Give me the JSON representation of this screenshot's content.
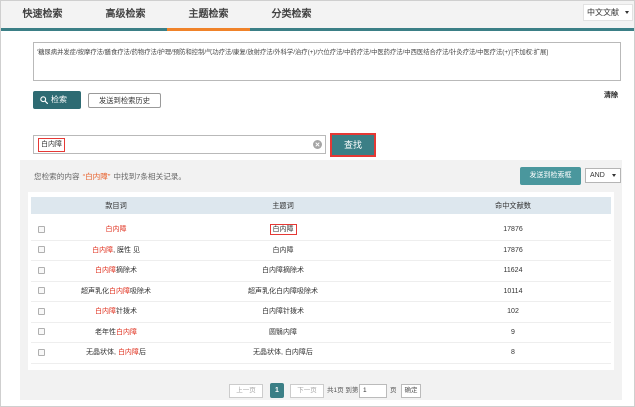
{
  "tabs": [
    {
      "label": "快速检索",
      "active": false
    },
    {
      "label": "高级检索",
      "active": false
    },
    {
      "label": "主题检索",
      "active": true
    },
    {
      "label": "分类检索",
      "active": false
    }
  ],
  "database": {
    "selected": "中文文献",
    "icon": "caret-down-icon"
  },
  "query_box": {
    "text": "'糖尿病并发症/按摩疗法/膳食疗法/药物疗法/护理/预防和控制/气功疗法/康复/放射疗法/外科学/治疗(+)/穴位疗法/中药疗法/中医药疗法/中西医结合疗法/针灸疗法/中医疗法(+)'[不加权:扩展]"
  },
  "actions": {
    "search_label": "检索",
    "search_icon": "search-icon",
    "send_history_label": "发送到检索历史",
    "clear_label": "清除"
  },
  "lookup": {
    "value": "白内障",
    "clear_icon": "clear-circle-icon",
    "button_label": "查找"
  },
  "results": {
    "summary": {
      "prefix": "您检索的内容",
      "term": "“白内障”",
      "suffix": "中找到7条相关记录。"
    },
    "send_button_label": "发送到检索框",
    "operator": {
      "selected": "AND",
      "icon": "caret-down-icon"
    },
    "columns": {
      "entry": "款目词",
      "subject": "主题词",
      "count": "命中文献数"
    },
    "rows": [
      {
        "checked": false,
        "entry": {
          "pre": "",
          "match": "白内障",
          "post": ""
        },
        "subject": "白内障",
        "count": 17876
      },
      {
        "checked": false,
        "entry": {
          "pre": "",
          "match": "白内障",
          "post": ", 膜性 见"
        },
        "subject": "白内障",
        "count": 17876
      },
      {
        "checked": false,
        "entry": {
          "pre": "",
          "match": "白内障",
          "post": "摘除术"
        },
        "subject": "白内障摘除术",
        "count": 11624
      },
      {
        "checked": false,
        "entry": {
          "pre": "超声乳化",
          "match": "白内障",
          "post": "吸除术"
        },
        "subject": "超声乳化白内障吸除术",
        "count": 10114
      },
      {
        "checked": false,
        "entry": {
          "pre": "",
          "match": "白内障",
          "post": "针拨术"
        },
        "subject": "白内障针拨术",
        "count": 102
      },
      {
        "checked": false,
        "entry": {
          "pre": "老年性",
          "match": "白内障",
          "post": ""
        },
        "subject": "圆翳内障",
        "count": 9
      },
      {
        "checked": false,
        "entry": {
          "pre": "无晶状体, ",
          "match": "白内障",
          "post": "后"
        },
        "subject": "无晶状体, 白内障后",
        "count": 8
      }
    ]
  },
  "pagination": {
    "prev_label": "上一页",
    "current_page": "1",
    "next_label": "下一页",
    "total_text": "共1页 到第",
    "goto_value": "1",
    "page_unit": "页",
    "confirm_label": "确定"
  },
  "colors": {
    "accent_teal": "#3b7f86",
    "accent_teal_dark": "#2e6b73",
    "accent_teal_light": "#4a979d",
    "active_tab": "#f0832a",
    "match_highlight": "#e0301e",
    "summary_term": "#e8612c",
    "table_header_bg": "#dde7ee",
    "annotation_red": "#e53935"
  }
}
